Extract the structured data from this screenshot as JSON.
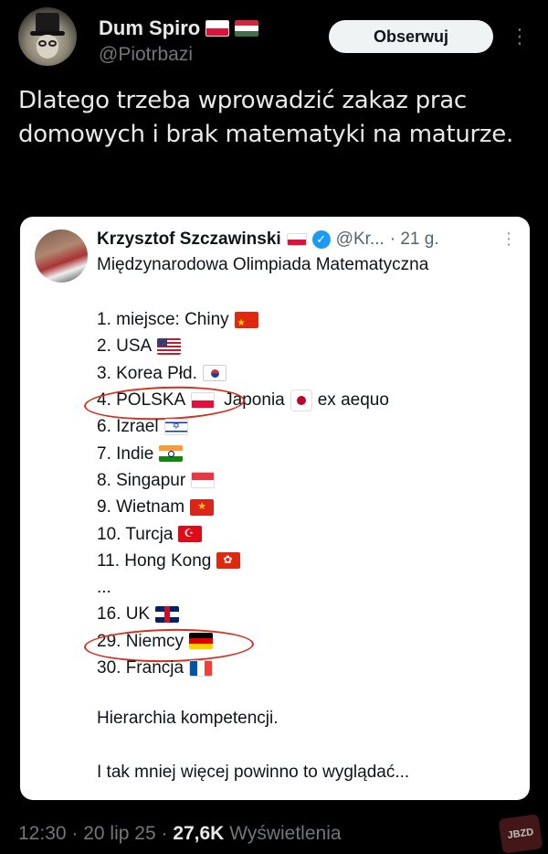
{
  "author": {
    "display_name": "Dum Spiro",
    "handle": "@Piotrbazi",
    "flags": [
      "pl",
      "hu"
    ]
  },
  "follow_label": "Obserwuj",
  "more_label": "⋮",
  "tweet_text": "Dlatego trzeba wprowadzić zakaz prac domowych i brak matematyki na maturze.",
  "quote": {
    "display_name": "Krzysztof Szczawinski",
    "handle": "@Kr...",
    "time": "· 21 g.",
    "more_label": "⋮",
    "subtitle": "Międzynarodowa Olimpiada Matematyczna",
    "ranking": [
      {
        "text": "1. miejsce: Chiny",
        "flag": "cn"
      },
      {
        "text": "2. USA",
        "flag": "us"
      },
      {
        "text": "3. Korea Płd.",
        "flag": "kr"
      },
      {
        "text": "4. POLSKA",
        "flag": "pl",
        "extra_country": "Japonia",
        "extra_flag": "jp",
        "extra_note": "ex aequo",
        "circled": true
      },
      {
        "text": "6. Izrael",
        "flag": "il"
      },
      {
        "text": "7. Indie",
        "flag": "in"
      },
      {
        "text": "8. Singapur",
        "flag": "sg"
      },
      {
        "text": "9. Wietnam",
        "flag": "vn"
      },
      {
        "text": "10. Turcja",
        "flag": "tr"
      },
      {
        "text": "11. Hong Kong",
        "flag": "hk"
      },
      {
        "text": "...",
        "flag": ""
      },
      {
        "text": "16. UK",
        "flag": "uk"
      },
      {
        "text": "29. Niemcy",
        "flag": "de",
        "circled": true
      },
      {
        "text": "30. Francja",
        "flag": "fr"
      }
    ],
    "closing_1": "Hierarchia kompetencji.",
    "closing_2": "I tak mniej więcej powinno to wyglądać..."
  },
  "footer": {
    "time": "12:30",
    "date": "20 lip 25",
    "views_count": "27,6K",
    "views_label": "Wyświetlenia"
  },
  "watermark": "JBZD",
  "colors": {
    "background": "#000000",
    "card": "#ffffff",
    "verified": "#1d9bf0",
    "annotation_circle": "#d3321f"
  }
}
